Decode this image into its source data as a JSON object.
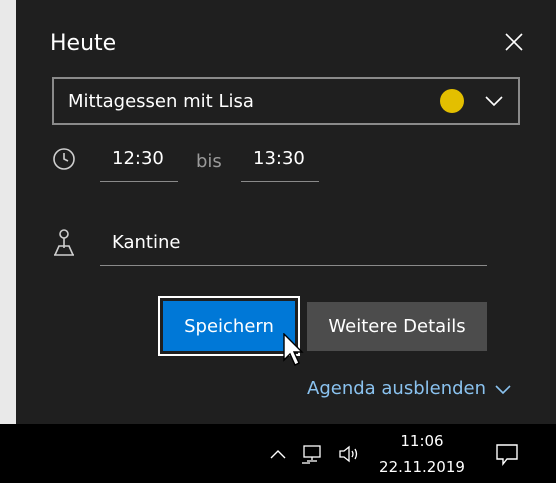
{
  "flyout": {
    "title": "Heute",
    "event_title": "Mittagessen mit Lisa",
    "event_color": "#e3bf00",
    "start_time": "12:30",
    "between_label": "bis",
    "end_time": "13:30",
    "location": "Kantine",
    "save_label": "Speichern",
    "details_label": "Weitere Details",
    "agenda_label": "Agenda ausblenden"
  },
  "taskbar": {
    "time": "11:06",
    "date": "22.11.2019"
  },
  "colors": {
    "accent": "#0078d7",
    "link": "#8ac2ef",
    "background": "#1f1f1f"
  },
  "icons": [
    "close-icon",
    "chevron-down-icon",
    "clock-icon",
    "location-pin-icon",
    "chevron-up-icon",
    "network-icon",
    "volume-icon",
    "notification-icon"
  ]
}
